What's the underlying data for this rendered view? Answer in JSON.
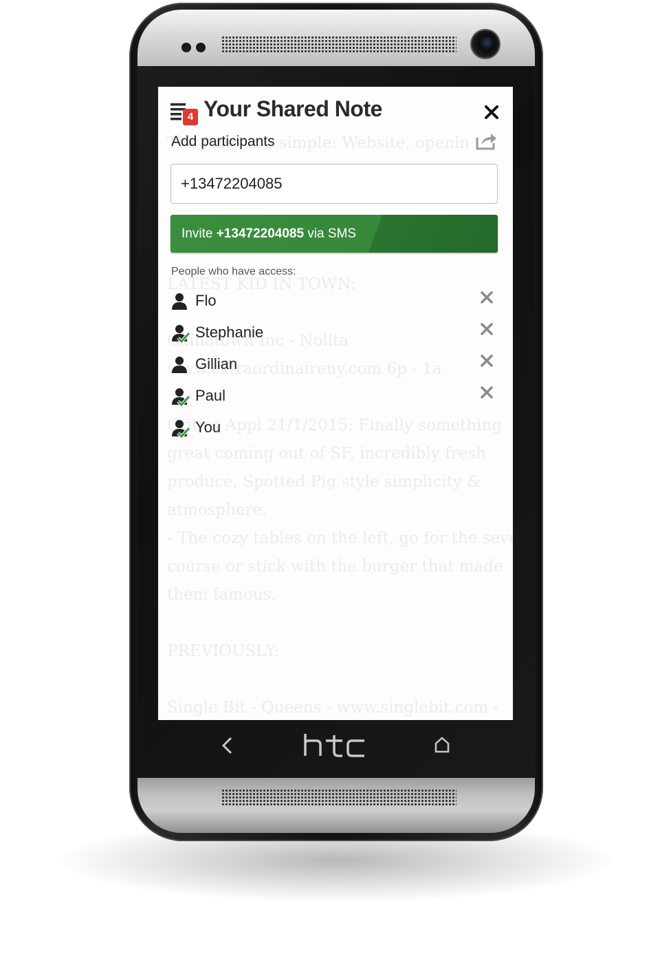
{
  "device": {
    "brand_logo": "htc",
    "nav": {
      "back_glyph": "<",
      "home_icon": "home-icon"
    }
  },
  "background_note": {
    "lines": [
      "The rules are simple: Website, openin",
      "",
      "",
      "",
      "",
      "LATEST KID IN TOWN:",
      "",
      "Chinatown Inc - Nolita",
      "  www.extraordinaireny.com  6p - 1a",
      "",
      "Critics Appl 21/1/2015: Finally something",
      "great coming out of SF, incredibly fresh",
      "produce, Spotted Pig style simplicity &",
      "atmosphere.",
      "- The cozy tables on the left, go for the seven",
      "course or stick with the burger that made",
      "them famous.",
      "",
      "PREVIOUSLY:",
      "",
      "Single Bit - Queens -  www.singlebit.com  -"
    ]
  },
  "header": {
    "menu_icon": "list-icon",
    "badge_count": "4",
    "title": "Your Shared Note",
    "close_icon": "close-icon",
    "share_icon": "share-icon"
  },
  "add_participants": {
    "label": "Add participants",
    "phone_value": "+13472204085",
    "invite_prefix": "Invite ",
    "invite_number": "+13472204085",
    "invite_suffix": " via SMS"
  },
  "access": {
    "label": "People who have access:",
    "people": [
      {
        "name": "Flo",
        "verified": false,
        "removable": true
      },
      {
        "name": "Stephanie",
        "verified": true,
        "removable": true
      },
      {
        "name": "Gillian",
        "verified": false,
        "removable": true
      },
      {
        "name": "Paul",
        "verified": true,
        "removable": true
      },
      {
        "name": "You",
        "verified": true,
        "removable": false
      }
    ]
  },
  "colors": {
    "accent_green": "#37883a",
    "badge_red": "#e03a30",
    "check_green": "#3a9a3c"
  }
}
